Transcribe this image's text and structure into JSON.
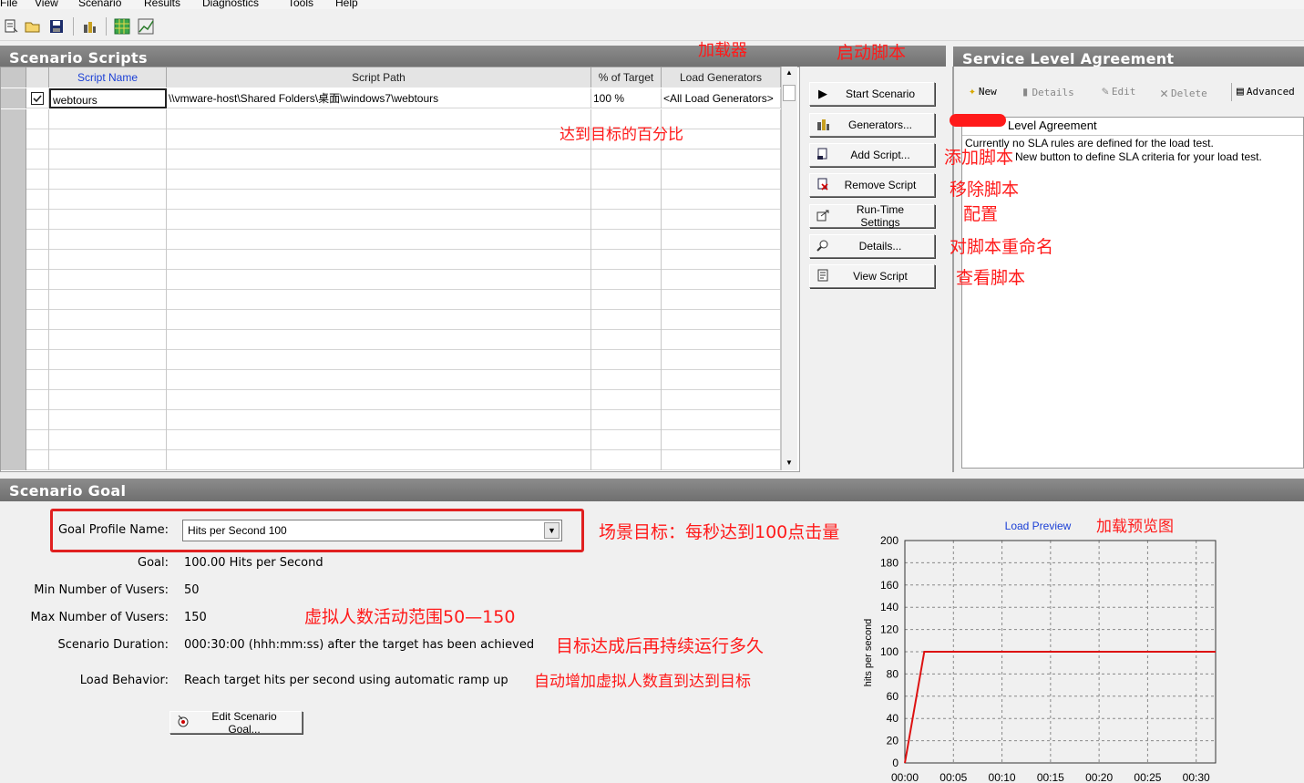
{
  "menu": [
    "File",
    "View",
    "Scenario",
    "Results",
    "Diagnostics",
    "Tools",
    "Help"
  ],
  "scripts_panel": {
    "title": "Scenario Scripts",
    "columns": [
      "Script Name",
      "Script Path",
      "% of Target",
      "Load Generators"
    ],
    "rows": [
      {
        "checked": true,
        "name": "webtours",
        "path": "\\\\vmware-host\\Shared Folders\\桌面\\windows7\\webtours",
        "percent": "100 %",
        "generators": "<All Load Generators>"
      }
    ]
  },
  "buttons": {
    "start": "Start Scenario",
    "generators": "Generators...",
    "add": "Add Script...",
    "remove": "Remove Script",
    "runtime": "Run-Time Settings",
    "details": "Details...",
    "view": "View Script"
  },
  "sla": {
    "title": "Service Level Agreement",
    "toolbar": {
      "new": "New",
      "details": "Details",
      "edit": "Edit",
      "delete": "Delete",
      "advanced": "Advanced"
    },
    "box_title": "Level Agreement",
    "line1": "Currently no SLA rules are defined for the load test.",
    "line2": "New button to define SLA criteria for your load test."
  },
  "goal": {
    "title": "Scenario Goal",
    "profile_label": "Goal Profile Name:",
    "profile_value": "Hits per Second 100",
    "goal_label": "Goal:",
    "goal_value": "100.00 Hits per Second",
    "min_label": "Min Number of Vusers:",
    "min_value": "50",
    "max_label": "Max Number of Vusers:",
    "max_value": "150",
    "duration_label": "Scenario Duration:",
    "duration_value": "000:30:00 (hhh:mm:ss) after the target has been achieved",
    "behavior_label": "Load Behavior:",
    "behavior_value": "Reach target hits per second using automatic ramp up",
    "edit_button": "Edit Scenario Goal..."
  },
  "annotations": {
    "load_generator": "加载器",
    "start_script": "启动脚本",
    "percent_target": "达到目标的百分比",
    "add_script": "添加脚本",
    "remove_script": "移除脚本",
    "config": "配置",
    "rename": "对脚本重命名",
    "view_script": "查看脚本",
    "goal": "场景目标：每秒达到100点击量",
    "preview": "加载预览图",
    "vuser_range": "虚拟人数活动范围50—150",
    "duration": "目标达成后再持续运行多久",
    "behavior": "自动增加虚拟人数直到达到目标"
  },
  "colors": {
    "annotation": "#ff1a1a",
    "header_gray": "#7a7a7a",
    "chart_line": "#dd1111",
    "script_name_header": "#1a3fd6"
  },
  "chart_data": {
    "type": "line",
    "title": "Load Preview",
    "ylabel": "hits per second",
    "xlabel": "",
    "x_ticks": [
      "00:00",
      "00:05",
      "00:10",
      "00:15",
      "00:20",
      "00:25",
      "00:30"
    ],
    "y_ticks": [
      0,
      20,
      40,
      60,
      80,
      100,
      120,
      140,
      160,
      180,
      200
    ],
    "ylim": [
      0,
      200
    ],
    "xlim_minutes": [
      0,
      32
    ],
    "series": [
      {
        "x_minutes": [
          0,
          2,
          32
        ],
        "values": [
          0,
          100,
          100
        ]
      }
    ],
    "grid": true
  }
}
